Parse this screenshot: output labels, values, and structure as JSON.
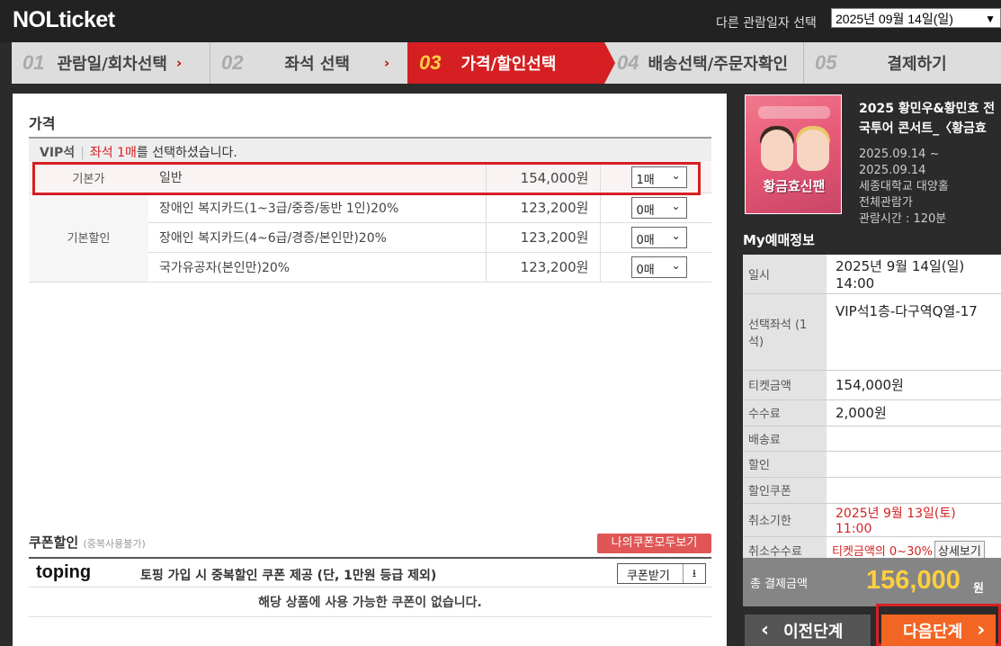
{
  "header": {
    "logo": "NOLticket",
    "date_label": "다른 관람일자 선택",
    "date_value": "2025년 09월 14일(일)"
  },
  "steps": [
    {
      "num": "01",
      "label": "관람일/회차선택"
    },
    {
      "num": "02",
      "label": "좌석 선택"
    },
    {
      "num": "03",
      "label": "가격/할인선택"
    },
    {
      "num": "04",
      "label": "배송선택/주문자확인"
    },
    {
      "num": "05",
      "label": "결제하기"
    }
  ],
  "price_section": {
    "title": "가격",
    "seat_grade": "VIP석",
    "seat_sel_pre": "좌석 1매",
    "seat_sel_post": "를 선택하셨습니다.",
    "rows": [
      {
        "category": "기본가",
        "name": "일반",
        "price": "154,000원",
        "qty": "1매"
      },
      {
        "category": "기본할인",
        "name": "장애인 복지카드(1~3급/중증/동반 1인)20%",
        "price": "123,200원",
        "qty": "0매"
      },
      {
        "category": "",
        "name": "장애인 복지카드(4~6급/경증/본인만)20%",
        "price": "123,200원",
        "qty": "0매"
      },
      {
        "category": "",
        "name": "국가유공자(본인만)20%",
        "price": "123,200원",
        "qty": "0매"
      }
    ]
  },
  "coupon": {
    "title": "쿠폰할인",
    "note": "(중복사용불가)",
    "view_all": "나의쿠폰모두보기",
    "brand": "toping",
    "desc": "토핑 가입 시 중복할인 쿠폰 제공 (단, 1만원 등급 제외)",
    "get_btn": "쿠폰받기",
    "empty": "해당 상품에 사용 가능한 쿠폰이 없습니다."
  },
  "show": {
    "title": "2025 황민우&황민호 전국투어 콘서트_〈황금효",
    "poster_text": "황금효신팬",
    "period": "2025.09.14 ~",
    "period_end": "2025.09.14",
    "venue": "세종대학교 대양홀",
    "rating": "전체관람가",
    "runtime": "관람시간 : 120분"
  },
  "my": {
    "title": "My예매정보",
    "rows": [
      {
        "key": "일시",
        "value": "2025년 9월 14일(일) 14:00"
      },
      {
        "key": "선택좌석 (1석)",
        "value": "VIP석1층-다구역Q열-17"
      },
      {
        "key": "티켓금액",
        "value": "154,000원"
      },
      {
        "key": "수수료",
        "value": "2,000원"
      },
      {
        "key": "배송료",
        "value": ""
      },
      {
        "key": "할인",
        "value": ""
      },
      {
        "key": "할인쿠폰",
        "value": ""
      },
      {
        "key": "취소기한",
        "value": "2025년 9월 13일(토) 11:00"
      },
      {
        "key": "취소수수료",
        "value": "티켓금액의 0~30%"
      }
    ],
    "detail_btn": "상세보기",
    "total_label": "총 결제금액",
    "total_amount": "156,000",
    "total_unit": "원"
  },
  "buttons": {
    "prev": "이전단계",
    "next": "다음단계"
  },
  "colors": {
    "accent_red": "#d61f22",
    "next_orange": "#f26522",
    "total_yellow": "#ffcf3f"
  }
}
